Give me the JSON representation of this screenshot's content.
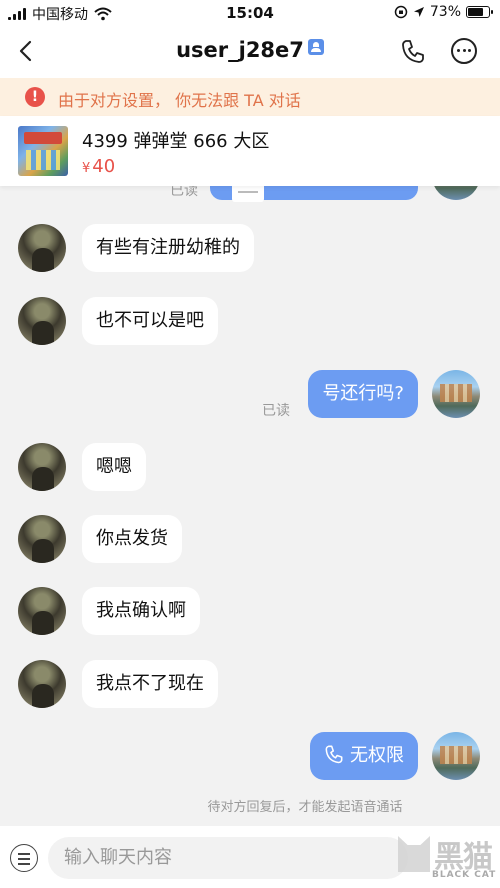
{
  "status_bar": {
    "carrier": "中国移动",
    "time": "15:04",
    "battery": "73%",
    "battery_level": 0.73
  },
  "header": {
    "title": "user_j28e7",
    "icons": [
      "back-arrow-icon",
      "verified-badge-icon",
      "phone-icon",
      "more-icon"
    ]
  },
  "banner": {
    "icon": "!",
    "text": "由于对方设置， 你无法跟 TA 对话"
  },
  "product": {
    "name": "4399 弹弹堂 666 大区",
    "currency": "¥",
    "price": "40"
  },
  "messages": [
    {
      "from": "other",
      "text": "有些有注册幼稚的"
    },
    {
      "from": "other",
      "text": "也不可以是吧"
    },
    {
      "from": "me",
      "text": "号还行吗?",
      "status": "已读"
    },
    {
      "from": "other",
      "text": "嗯嗯"
    },
    {
      "from": "other",
      "text": "你点发货"
    },
    {
      "from": "other",
      "text": "我点确认啊"
    },
    {
      "from": "other",
      "text": "我点不了现在"
    },
    {
      "from": "me",
      "text": "无权限",
      "icon": "phone-icon"
    }
  ],
  "partial_read": "已读",
  "footer_note": "待对方回复后，才能发起语音通话",
  "input": {
    "placeholder": "输入聊天内容"
  },
  "watermark": {
    "main": "黑猫",
    "sub": "BLACK CAT"
  }
}
